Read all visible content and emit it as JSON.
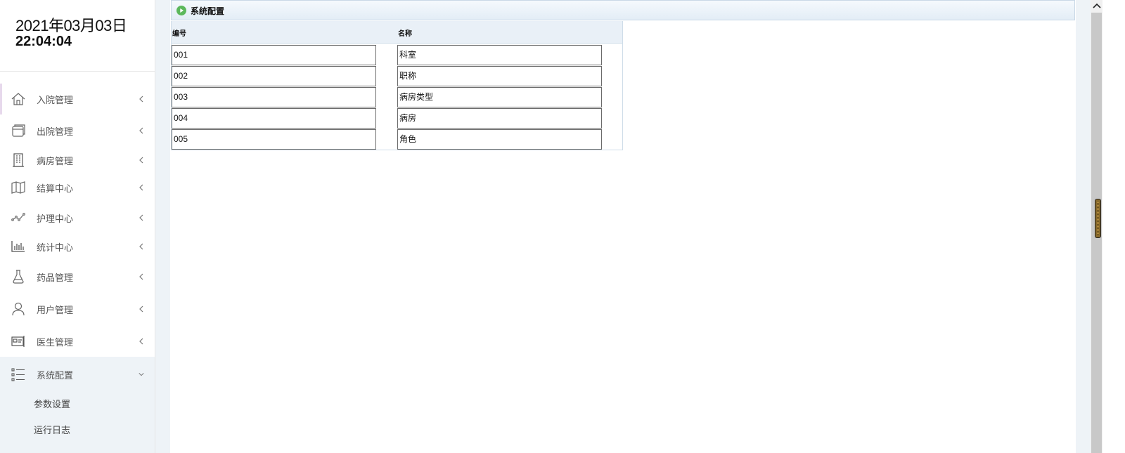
{
  "clock": {
    "date": "2021年03月03日",
    "time": "22:04:04"
  },
  "sidebar": {
    "items": [
      {
        "label": "入院管理",
        "icon": "home-icon",
        "name": "admission"
      },
      {
        "label": "出院管理",
        "icon": "window-icon",
        "name": "discharge"
      },
      {
        "label": "病房管理",
        "icon": "building-icon",
        "name": "ward"
      },
      {
        "label": "结算中心",
        "icon": "map-icon",
        "name": "settlement"
      },
      {
        "label": "护理中心",
        "icon": "line-chart-icon",
        "name": "nursing"
      },
      {
        "label": "统计中心",
        "icon": "bar-chart-icon",
        "name": "statistics"
      },
      {
        "label": "药品管理",
        "icon": "flask-icon",
        "name": "medicine"
      },
      {
        "label": "用户管理",
        "icon": "user-icon",
        "name": "users"
      },
      {
        "label": "医生管理",
        "icon": "id-card-icon",
        "name": "doctors"
      },
      {
        "label": "系统配置",
        "icon": "list-icon",
        "name": "system-config"
      }
    ],
    "sub_items": [
      {
        "label": "参数设置"
      },
      {
        "label": "运行日志"
      }
    ]
  },
  "panel": {
    "title": "系统配置"
  },
  "table": {
    "columns": [
      "编号",
      "名称"
    ],
    "rows": [
      [
        "001",
        "科室"
      ],
      [
        "002",
        "职称"
      ],
      [
        "003",
        "病房类型"
      ],
      [
        "004",
        "病房"
      ],
      [
        "005",
        "角色"
      ]
    ]
  },
  "colors": {
    "accent_green": "#5cb85c",
    "header_bg": "#e9f0f7",
    "sidebar_expanded_bg": "#eef3f7"
  }
}
